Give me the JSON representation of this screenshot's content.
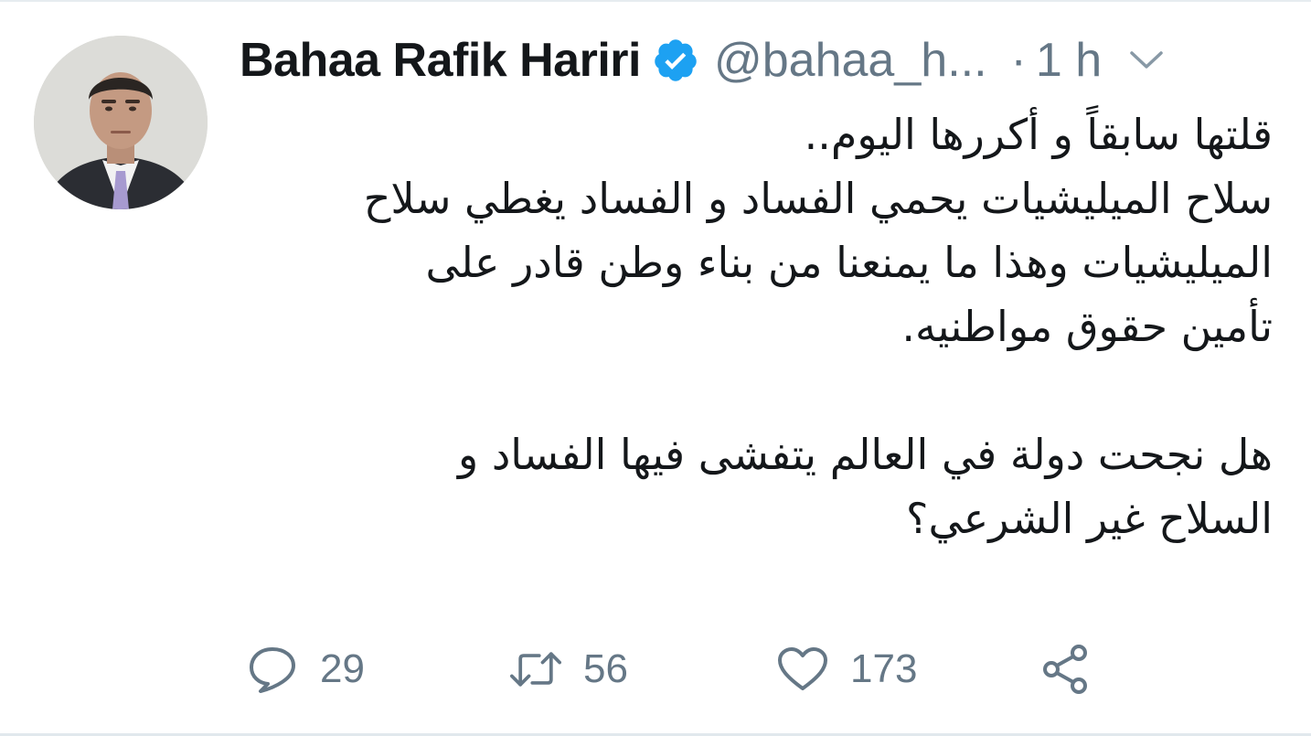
{
  "tweet": {
    "author": {
      "display_name": "Bahaa Rafik Hariri",
      "handle": "@bahaa_h...",
      "verified": true
    },
    "separator": "·",
    "time": "1 h",
    "body_lines": [
      "قلتها سابقاً و أكررها اليوم..",
      "سلاح الميليشيات يحمي الفساد و الفساد يغطي سلاح",
      "الميليشيات وهذا ما يمنعنا من بناء وطن قادر على",
      "تأمين حقوق مواطنيه.",
      "",
      "هل نجحت دولة في العالم يتفشى فيها الفساد و",
      "السلاح غير الشرعي؟"
    ],
    "actions": {
      "reply": {
        "icon": "reply-icon",
        "count": "29"
      },
      "retweet": {
        "icon": "retweet-icon",
        "count": "56"
      },
      "like": {
        "icon": "heart-icon",
        "count": "173"
      },
      "share": {
        "icon": "share-icon"
      }
    }
  },
  "colors": {
    "text": "#14171a",
    "secondary": "#657786",
    "verified_blue": "#1da1f2"
  }
}
